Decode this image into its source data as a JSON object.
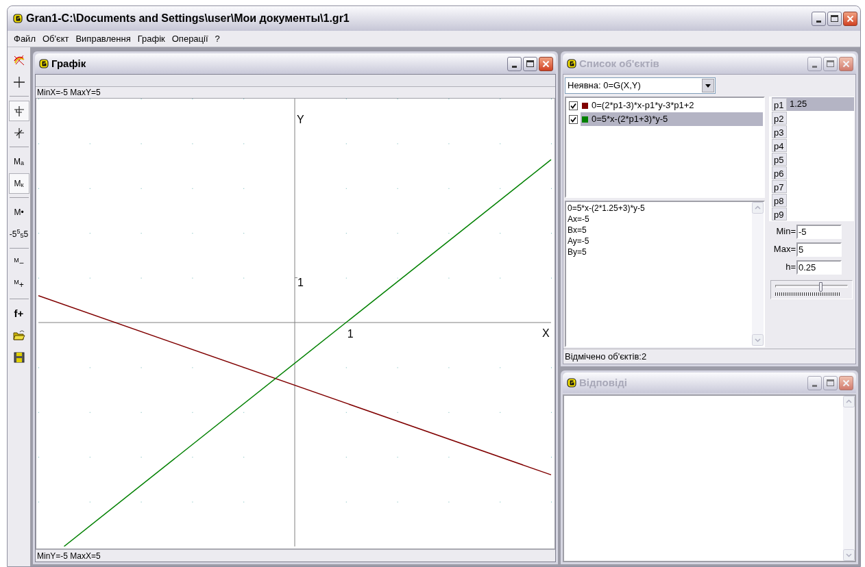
{
  "window": {
    "title": "Gran1-C:\\Documents and Settings\\user\\Мои документы\\1.gr1"
  },
  "menu": [
    "Файл",
    "Об'єкт",
    "Виправлення",
    "Графік",
    "Операції",
    "?"
  ],
  "toolbar": [
    {
      "kind": "graph",
      "pressed": false
    },
    {
      "kind": "cross",
      "pressed": false
    },
    {
      "kind": "separator"
    },
    {
      "kind": "axis-t",
      "pressed": true
    },
    {
      "kind": "axis-k",
      "pressed": false
    },
    {
      "kind": "separator"
    },
    {
      "kind": "text",
      "label": "M$_{a}$",
      "pressed": false
    },
    {
      "kind": "text",
      "label": "M$_{к}$",
      "pressed": true
    },
    {
      "kind": "separator"
    },
    {
      "kind": "text",
      "label": "M•",
      "pressed": false
    },
    {
      "kind": "text",
      "label": "-5$^{5}$$_{5}$5",
      "pressed": false
    },
    {
      "kind": "separator"
    },
    {
      "kind": "text",
      "label": "$^{M}$−",
      "pressed": false
    },
    {
      "kind": "text",
      "label": "$^{M}$+",
      "pressed": false
    },
    {
      "kind": "separator"
    },
    {
      "kind": "text",
      "label": "f+",
      "pressed": false
    },
    {
      "kind": "open",
      "pressed": false
    },
    {
      "kind": "save",
      "pressed": false
    }
  ],
  "graph_window": {
    "title": "Графік",
    "active": true,
    "status_top": "MinX=-5  MaxY=5",
    "status_bottom": "MinY=-5  MaxX=5",
    "plot": {
      "x_axis_label": "X",
      "y_axis_label": "Y",
      "x_unit_label": "1",
      "y_unit_label": "1"
    }
  },
  "objects_window": {
    "title": "Список об'єктів",
    "active": false,
    "type_select": "Неявна: 0=G(X,Y)",
    "objects": [
      {
        "formula": "0=(2*p1-3)*x-p1*y-3*p1+2",
        "checked": true,
        "color": "#800000",
        "selected": false
      },
      {
        "formula": "0=5*x-(2*p1+3)*y-5",
        "checked": true,
        "color": "#008000",
        "selected": true
      }
    ],
    "details": [
      "0=5*x-(2*1.25+3)*y-5",
      "Ax=-5",
      "Bx=5",
      "Ay=-5",
      "By=5"
    ],
    "params": [
      {
        "name": "p1",
        "value": "1.25",
        "selected": true
      },
      {
        "name": "p2",
        "selected": false
      },
      {
        "name": "p3",
        "selected": false
      },
      {
        "name": "p4",
        "selected": false
      },
      {
        "name": "p5",
        "selected": false
      },
      {
        "name": "p6",
        "selected": false
      },
      {
        "name": "p7",
        "selected": false
      },
      {
        "name": "p8",
        "selected": false
      },
      {
        "name": "p9",
        "selected": false
      }
    ],
    "range": [
      {
        "label": "Min=",
        "value": "-5"
      },
      {
        "label": "Max=",
        "value": "5"
      },
      {
        "label": "h=",
        "value": "0.25"
      }
    ],
    "slider": {
      "level": 0.625
    },
    "status": "Відмічено об'єктів:2"
  },
  "answers_window": {
    "title": "Відповіді",
    "active": false
  }
}
